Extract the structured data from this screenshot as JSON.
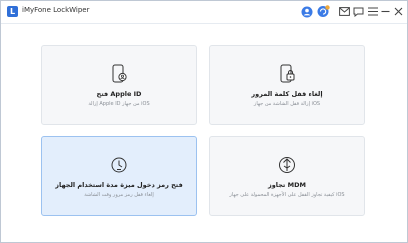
{
  "window": {
    "app_name": "iMyFone LockWiper",
    "logo_letter": "L"
  },
  "titlebar": {
    "icons": [
      "user-icon",
      "refresh-badge-icon",
      "mail-icon",
      "chat-icon",
      "menu-icon",
      "minimize-icon",
      "close-icon"
    ]
  },
  "cards": [
    {
      "title": "إلغاء قفل كلمة المرور",
      "desc": "إزالة قفل الشاشة من جهاز iOS",
      "icon": "phone-lock-icon"
    },
    {
      "title": "فتح Apple ID",
      "desc": "إزالة Apple ID من جهاز iOS",
      "icon": "phone-id-icon"
    },
    {
      "title": "تجاوز MDM",
      "desc": "كيفية تجاوز القفل على الأجهزة المحمولة على جهاز iOS",
      "icon": "mdm-icon"
    },
    {
      "title": "فتح رمز دخول ميزة مدة استخدام الجهاز",
      "desc": "إلغاء قفل رمز مرور وقت الشاشة",
      "icon": "screen-time-icon"
    }
  ],
  "colors": {
    "accent": "#2f6fd8",
    "card_bg": "#f6f7f9",
    "selected_bg": "#e3eefc",
    "selected_border": "#9cc2f0"
  }
}
